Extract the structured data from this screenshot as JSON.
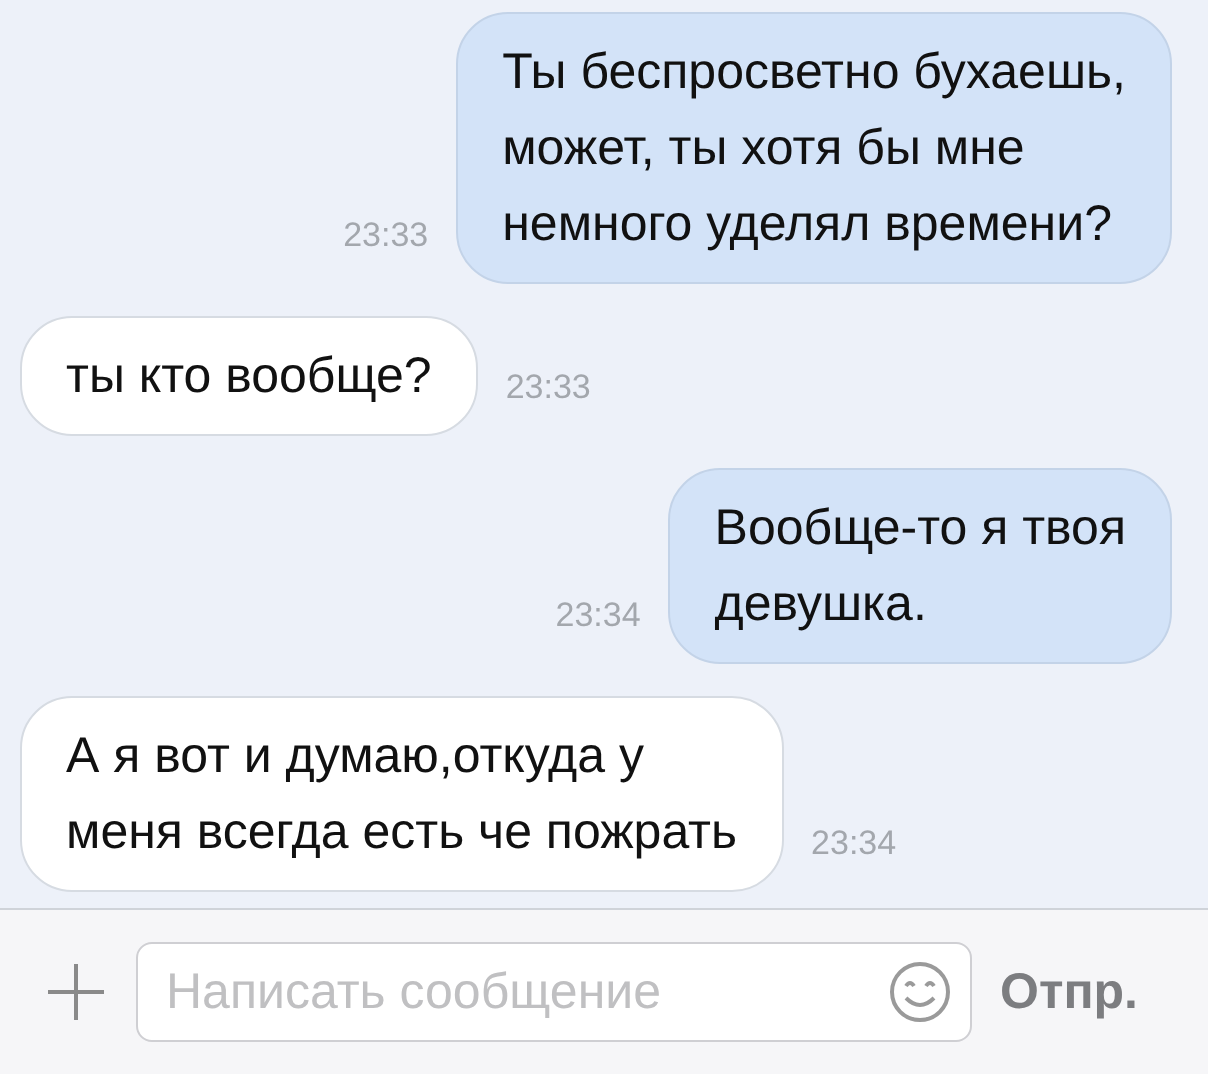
{
  "messages": [
    {
      "kind": "outgoing",
      "text": "Ты беспросветно бухаешь,\nможет, ты хотя бы мне\nнемного уделял времени?",
      "time": "23:33"
    },
    {
      "kind": "incoming",
      "text": "ты кто вообще?",
      "time": "23:33"
    },
    {
      "kind": "outgoing",
      "text": "Вообще-то я твоя\nдевушка.",
      "time": "23:34"
    },
    {
      "kind": "incoming",
      "text": "А я вот и думаю,откуда у\nменя всегда есть че пожрать",
      "time": "23:34"
    }
  ],
  "composer": {
    "placeholder": "Написать сообщение",
    "send": "Отпр."
  }
}
